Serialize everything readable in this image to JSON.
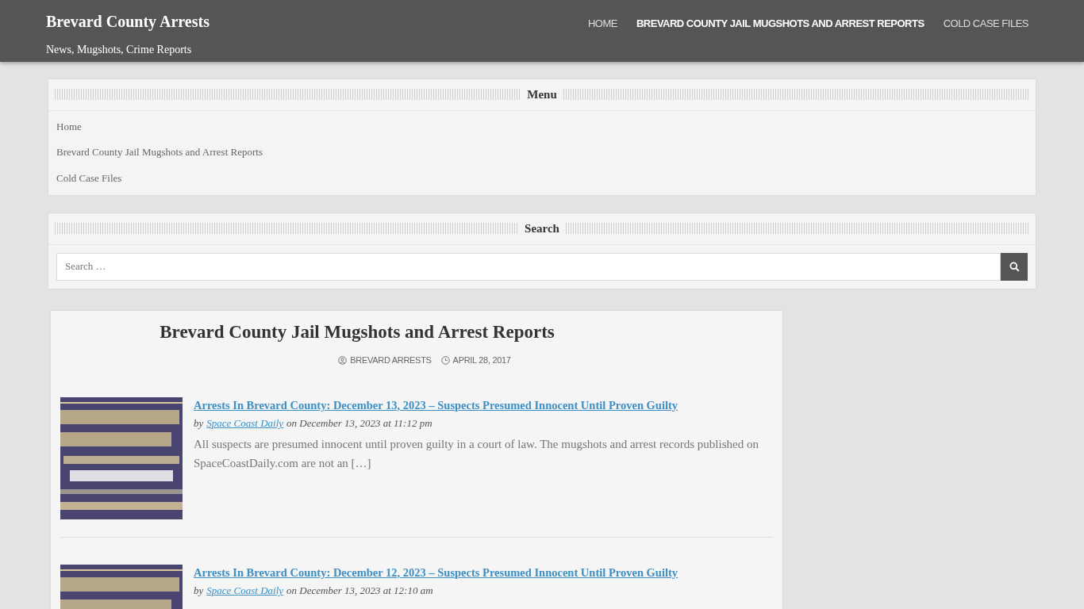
{
  "site": {
    "title": "Brevard County Arrests",
    "tagline": "News, Mugshots, Crime Reports"
  },
  "nav": [
    {
      "label": "HOME",
      "selected": false
    },
    {
      "label": "BREVARD COUNTY JAIL MUGSHOTS AND ARREST REPORTS",
      "selected": true
    },
    {
      "label": "COLD CASE FILES",
      "selected": false
    }
  ],
  "menu_widget": {
    "title": "Menu",
    "items": [
      "Home",
      "Brevard County Jail Mugshots and Arrest Reports",
      "Cold Case Files"
    ]
  },
  "search_widget": {
    "title": "Search",
    "placeholder": "Search …"
  },
  "page": {
    "title": "Brevard County Jail Mugshots and Arrest Reports",
    "author": "BREVARD ARRESTS",
    "date": "APRIL 28, 2017",
    "posts": [
      {
        "title": "Arrests In Brevard County: December 13, 2023 – Suspects Presumed Innocent Until Proven Guilty",
        "by": "by",
        "author": "Space Coast Daily",
        "when": "on December 13, 2023 at 11:12 pm",
        "excerpt": "All suspects are presumed innocent until proven guilty in a court of law. The mugshots and arrest records published on SpaceCoastDaily.com are not an […]"
      },
      {
        "title": "Arrests In Brevard County: December 12, 2023 – Suspects Presumed Innocent Until Proven Guilty",
        "by": "by",
        "author": "Space Coast Daily",
        "when": "on December 13, 2023 at 12:10 am"
      }
    ]
  }
}
